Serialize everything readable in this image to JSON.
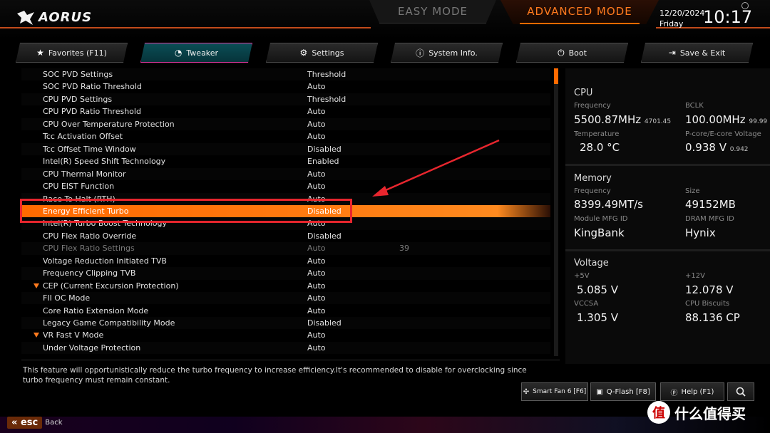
{
  "brand": "AORUS",
  "modes": {
    "easy": "EASY MODE",
    "advanced": "ADVANCED MODE"
  },
  "clock": {
    "date": "12/20/2024",
    "day": "Friday",
    "time": "10:17"
  },
  "tabs": [
    {
      "label": "Favorites (F11)",
      "icon": "star-icon"
    },
    {
      "label": "Tweaker",
      "icon": "gauge-icon",
      "active": true
    },
    {
      "label": "Settings",
      "icon": "gear-icon"
    },
    {
      "label": "System Info.",
      "icon": "info-icon"
    },
    {
      "label": "Boot",
      "icon": "power-icon"
    },
    {
      "label": "Save & Exit",
      "icon": "exit-icon"
    }
  ],
  "settings": [
    {
      "name": "SOC PVD Settings",
      "value": "Threshold"
    },
    {
      "name": "SOC PVD Ratio Threshold",
      "value": "Auto"
    },
    {
      "name": "CPU PVD Settings",
      "value": "Threshold"
    },
    {
      "name": "CPU PVD Ratio Threshold",
      "value": "Auto"
    },
    {
      "name": "CPU Over Temperature Protection",
      "value": "Auto"
    },
    {
      "name": "Tcc Activation Offset",
      "value": "Auto"
    },
    {
      "name": "Tcc Offset Time Window",
      "value": "Disabled"
    },
    {
      "name": "Intel(R) Speed Shift Technology",
      "value": "Enabled"
    },
    {
      "name": "CPU Thermal Monitor",
      "value": "Auto"
    },
    {
      "name": "CPU EIST Function",
      "value": "Auto"
    },
    {
      "name": "Race To Halt (RTH)",
      "value": "Auto"
    },
    {
      "name": "Energy Efficient Turbo",
      "value": "Disabled",
      "selected": true
    },
    {
      "name": "Intel(R) Turbo Boost Technology",
      "value": "Auto"
    },
    {
      "name": "CPU Flex Ratio Override",
      "value": "Disabled"
    },
    {
      "name": "CPU Flex Ratio Settings",
      "value": "Auto",
      "extra": "39",
      "dim": true
    },
    {
      "name": "Voltage Reduction Initiated TVB",
      "value": "Auto"
    },
    {
      "name": "Frequency Clipping TVB",
      "value": "Auto"
    },
    {
      "name": "CEP (Current Excursion Protection)",
      "value": "Auto",
      "expand": true
    },
    {
      "name": "FII OC Mode",
      "value": "Auto"
    },
    {
      "name": "Core Ratio Extension Mode",
      "value": "Auto"
    },
    {
      "name": "Legacy Game Compatibility Mode",
      "value": "Disabled"
    },
    {
      "name": "VR Fast V Mode",
      "value": "Auto",
      "expand": true
    },
    {
      "name": "Under Voltage Protection",
      "value": "Auto"
    }
  ],
  "help_text": "This feature will opportunistically reduce the turbo frequency to increase efficiency.It's recommended to disable for overclocking since turbo frequency must remain constant.",
  "cpu": {
    "title": "CPU",
    "frequency_label": "Frequency",
    "frequency": "5500.87MHz",
    "frequency_sub": "4701.45",
    "bclk_label": "BCLK",
    "bclk": "100.00MHz",
    "bclk_sub": "99.99",
    "temperature_label": "Temperature",
    "temperature": "28.0 °C",
    "voltage_label": "P-core/E-core Voltage",
    "voltage": "0.938 V",
    "voltage_sub": "0.942"
  },
  "memory": {
    "title": "Memory",
    "frequency_label": "Frequency",
    "frequency": "8399.49MT/s",
    "size_label": "Size",
    "size": "49152MB",
    "module_label": "Module MFG ID",
    "module": "KingBank",
    "dram_label": "DRAM MFG ID",
    "dram": "Hynix"
  },
  "voltage": {
    "title": "Voltage",
    "v5_label": "+5V",
    "v5": "5.085 V",
    "v12_label": "+12V",
    "v12": "12.078 V",
    "vccsa_label": "VCCSA",
    "vccsa": "1.305 V",
    "biscuits_label": "CPU Biscuits",
    "biscuits": "88.136 CP"
  },
  "bottom_buttons": [
    {
      "label": "Smart Fan 6 [F6]",
      "icon": "fan-icon"
    },
    {
      "label": "Q-Flash [F8]",
      "icon": "qflash-icon"
    },
    {
      "label": "Help (F1)",
      "icon": "help-icon"
    },
    {
      "label": "",
      "icon": "search-icon"
    }
  ],
  "esc": {
    "key": "esc",
    "label": "Back"
  },
  "watermark": {
    "badge": "值",
    "text": "什么值得买"
  },
  "colors": {
    "accent": "#ff6a00",
    "highlight_box": "#e8262e",
    "tab_active_border": "#e23aa1"
  }
}
